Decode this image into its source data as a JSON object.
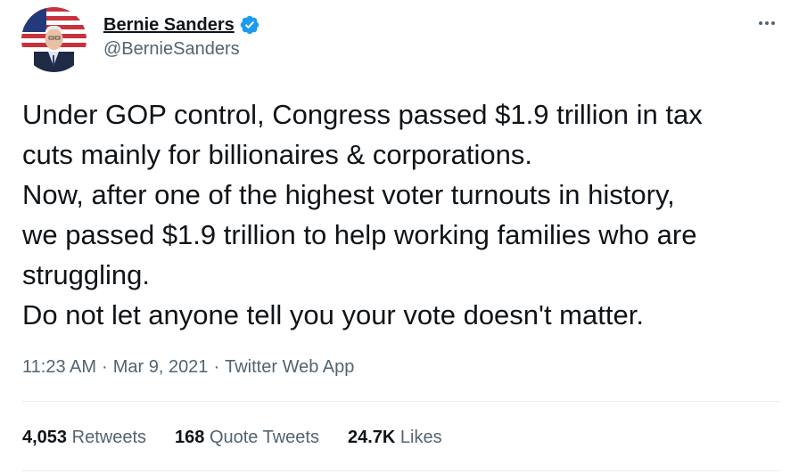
{
  "author": {
    "display_name": "Bernie Sanders",
    "handle": "@BernieSanders",
    "verified": true,
    "verified_color": "#1d9bf0"
  },
  "tweet": {
    "lines": [
      "Under GOP control, Congress passed $1.9 trillion in tax",
      "cuts mainly for billionaires & corporations.",
      "Now, after one of the highest voter turnouts in history,",
      "we passed $1.9 trillion to help working families who are",
      "struggling.",
      "Do not let anyone tell you your vote doesn't matter."
    ]
  },
  "meta": {
    "time": "11:23 AM",
    "separator": "·",
    "date": "Mar 9, 2021",
    "source": "Twitter Web App"
  },
  "stats": {
    "retweets": {
      "count": "4,053",
      "label": "Retweets"
    },
    "quotes": {
      "count": "168",
      "label": "Quote Tweets"
    },
    "likes": {
      "count": "24.7K",
      "label": "Likes"
    }
  },
  "icons": {
    "avatar": "profile-photo",
    "verified": "verified-badge-icon",
    "more": "more-options-icon"
  },
  "colors": {
    "text_primary": "#0f1419",
    "text_secondary": "#536471",
    "divider": "#e6ecf0"
  }
}
